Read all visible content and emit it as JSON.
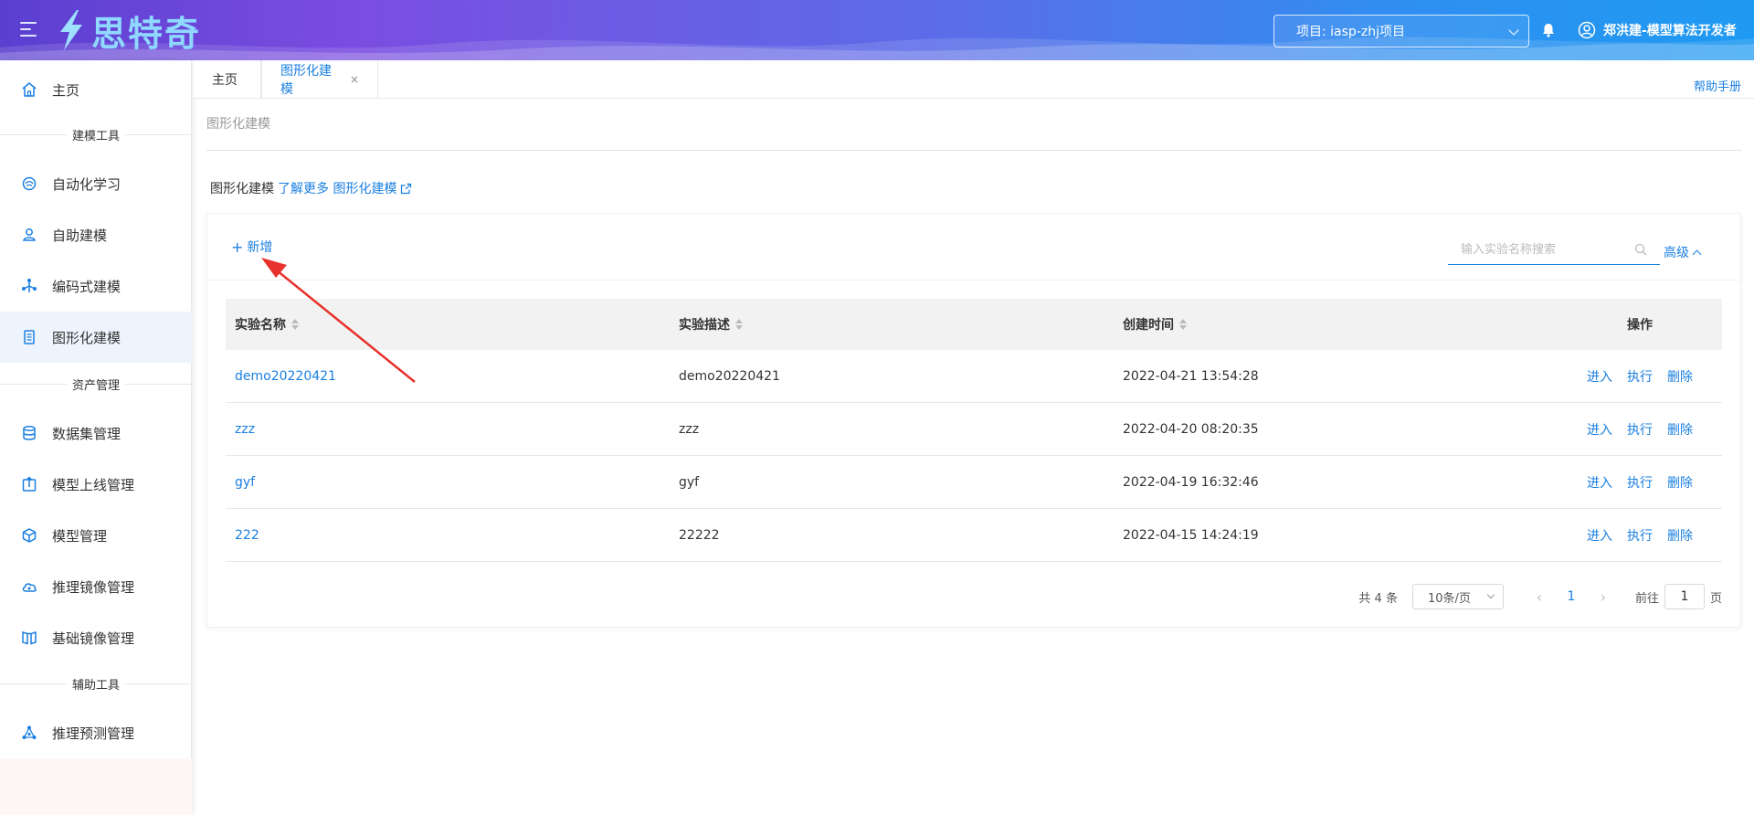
{
  "header": {
    "logo_text": "思特奇",
    "project": "项目: iasp-zhj项目",
    "user": "郑洪建-模型算法开发者"
  },
  "sidebar": {
    "home": "主页",
    "sections": [
      "建模工具",
      "资产管理",
      "辅助工具"
    ],
    "items": [
      {
        "label": "自动化学习",
        "icon": "brain-icon"
      },
      {
        "label": "自助建模",
        "icon": "user-model-icon"
      },
      {
        "label": "编码式建模",
        "icon": "code-fork-icon"
      },
      {
        "label": "图形化建模",
        "icon": "document-icon"
      },
      {
        "label": "数据集管理",
        "icon": "database-icon"
      },
      {
        "label": "模型上线管理",
        "icon": "upload-icon"
      },
      {
        "label": "模型管理",
        "icon": "cube-icon"
      },
      {
        "label": "推理镜像管理",
        "icon": "cloud-icon"
      },
      {
        "label": "基础镜像管理",
        "icon": "book-icon"
      },
      {
        "label": "推理预测管理",
        "icon": "network-icon"
      }
    ]
  },
  "tabs": {
    "home": "主页",
    "active": "图形化建模",
    "close": "×",
    "help": "帮助手册"
  },
  "breadcrumb": "图形化建模",
  "intro": {
    "title": "图形化建模",
    "link": "了解更多 图形化建模"
  },
  "toolbar": {
    "add": "新增",
    "search_placeholder": "输入实验名称搜索",
    "advanced": "高级"
  },
  "table": {
    "columns": [
      "实验名称",
      "实验描述",
      "创建时间",
      "操作"
    ],
    "rows": [
      {
        "name": "demo20220421",
        "desc": "demo20220421",
        "time": "2022-04-21 13:54:28"
      },
      {
        "name": "zzz",
        "desc": "zzz",
        "time": "2022-04-20 08:20:35"
      },
      {
        "name": "gyf",
        "desc": "gyf",
        "time": "2022-04-19 16:32:46"
      },
      {
        "name": "222",
        "desc": "22222",
        "time": "2022-04-15 14:24:19"
      }
    ],
    "actions": [
      "进入",
      "执行",
      "删除"
    ]
  },
  "pagination": {
    "total": "共 4 条",
    "page_size": "10条/页",
    "current": "1",
    "goto_prefix": "前往",
    "goto_value": "1",
    "goto_suffix": "页"
  },
  "colors": {
    "accent": "#1a7fe0",
    "header_start": "#5a3fd0",
    "header_end": "#1e9af2",
    "annotation_arrow": "#e8322d"
  }
}
